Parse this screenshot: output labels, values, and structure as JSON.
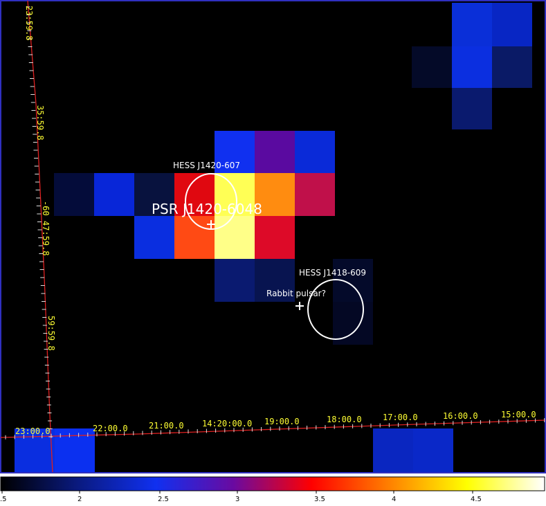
{
  "sky_image": {
    "pixels": [
      {
        "col": 0,
        "row": 0,
        "color": "#0a2fd8"
      },
      {
        "col": 1,
        "row": 0,
        "color": "#0826c4"
      },
      {
        "col": -1,
        "row": 1,
        "color": "#040a28"
      },
      {
        "col": 0,
        "row": 1,
        "color": "#0b2fe0"
      },
      {
        "col": 1,
        "row": 1,
        "color": "#0a1a66"
      },
      {
        "col": 0,
        "row": 2,
        "color": "#0a1a6e"
      },
      {
        "col": 0,
        "row": 3,
        "color": "#1030f0"
      },
      {
        "col": 1,
        "row": 3,
        "color": "#5a0aa0"
      },
      {
        "col": 2,
        "row": 3,
        "color": "#0a2ad8"
      },
      {
        "col": -4,
        "row": 4,
        "color": "#040c3a"
      },
      {
        "col": -3,
        "row": 4,
        "color": "#0826d8"
      },
      {
        "col": -2,
        "row": 4,
        "color": "#08123e"
      },
      {
        "col": -1,
        "row": 4,
        "color": "#e00810"
      },
      {
        "col": 0,
        "row": 4,
        "color": "#ffff55"
      },
      {
        "col": 1,
        "row": 4,
        "color": "#ff8c10"
      },
      {
        "col": 2,
        "row": 4,
        "color": "#c0104a"
      },
      {
        "col": -2,
        "row": 5,
        "color": "#0a2ee0"
      },
      {
        "col": -1,
        "row": 5,
        "color": "#ff4a14"
      },
      {
        "col": 0,
        "row": 5,
        "color": "#ffff88"
      },
      {
        "col": 1,
        "row": 5,
        "color": "#dd0a28"
      },
      {
        "col": 0,
        "row": 6,
        "color": "#0a1a70"
      },
      {
        "col": 1,
        "row": 6,
        "color": "#081450"
      },
      {
        "col": 3,
        "row": 6,
        "color": "#050a2a"
      },
      {
        "col": 3,
        "row": 7,
        "color": "#040a2a"
      },
      {
        "col": 3,
        "row": 8,
        "color": "#040824"
      },
      {
        "col": -5,
        "row": 10,
        "color": "#0a2ee0"
      },
      {
        "col": -4,
        "row": 10,
        "color": "#0b30f0"
      },
      {
        "col": 3,
        "row": 10,
        "color": "#0a26c0"
      },
      {
        "col": 4,
        "row": 10,
        "color": "#0a28c8"
      }
    ]
  },
  "dec_axis_labels": [
    "23:59.8",
    "35:59.8",
    "-60 47:59.8",
    "59:59.8"
  ],
  "ra_axis_labels": [
    "23:00.0",
    "22:00.0",
    "21:00.0",
    "14:20:00.0",
    "19:00.0",
    "18:00.0",
    "17:00.0",
    "16:00.0",
    "15:00.0"
  ],
  "annotations": {
    "hess1": "HESS J1420-607",
    "psr": "PSR J1420-6048",
    "hess2": "HESS J1418-609",
    "rabbit": "Rabbit pulsar?"
  },
  "colorbar": {
    "stops": [
      "#000000",
      "#0a1a80",
      "#1030f0",
      "#6a0aa0",
      "#ff0000",
      "#ff8000",
      "#ffff00",
      "#ffffff"
    ],
    "ticks": [
      ".5",
      "2",
      "2.5",
      "3",
      "3.5",
      "4",
      "4.5"
    ]
  },
  "colors": {
    "background": "#000000",
    "border": "#3030c0",
    "grid_line": "#e02020",
    "label": "#ffff33"
  }
}
